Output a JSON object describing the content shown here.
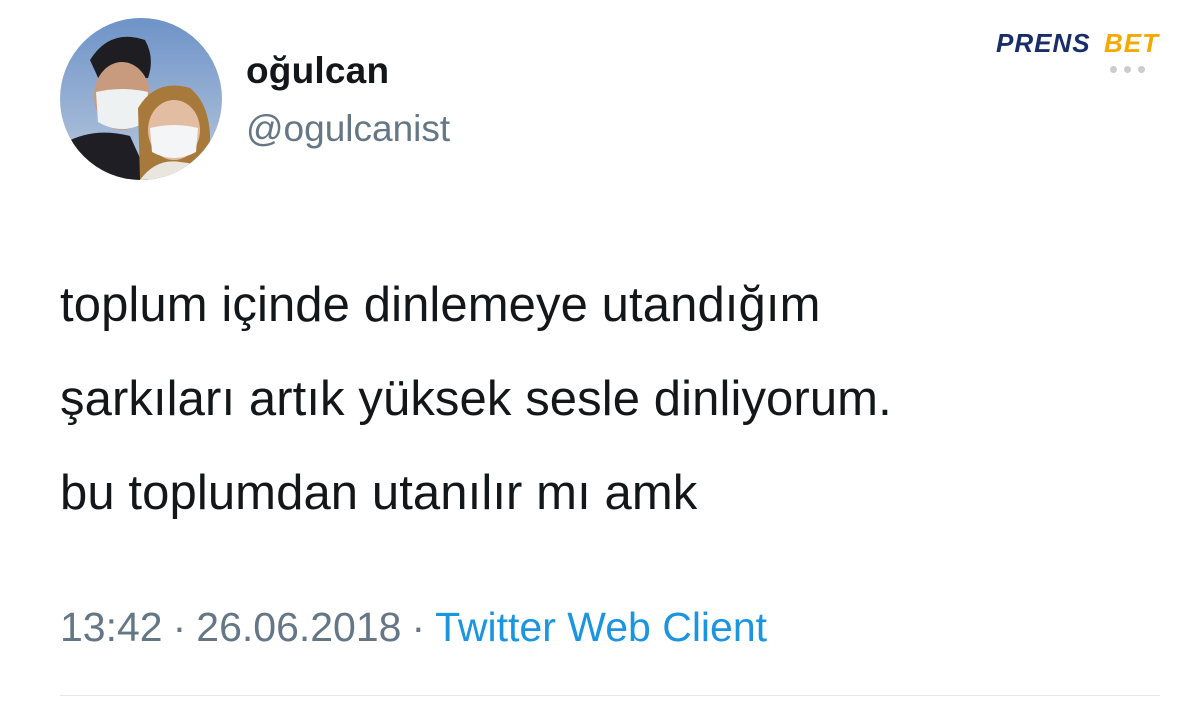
{
  "user": {
    "display_name": "oğulcan",
    "handle": "@ogulcanist"
  },
  "watermark": {
    "logo_text": "PRENSBET",
    "colors": [
      "#1a2d6b",
      "#f5a800"
    ]
  },
  "more_menu": {
    "icon": "ellipsis-horizontal-icon"
  },
  "tweet": {
    "lines": [
      "toplum içinde dinlemeye utandığım",
      "şarkıları artık yüksek sesle dinliyorum.",
      "bu toplumdan utanılır mı amk"
    ]
  },
  "meta": {
    "time": "13:42",
    "separator": "·",
    "date": "26.06.2018",
    "client": "Twitter Web Client"
  },
  "colors": {
    "text": "#14171a",
    "secondary": "#657786",
    "link": "#1b95e0"
  }
}
